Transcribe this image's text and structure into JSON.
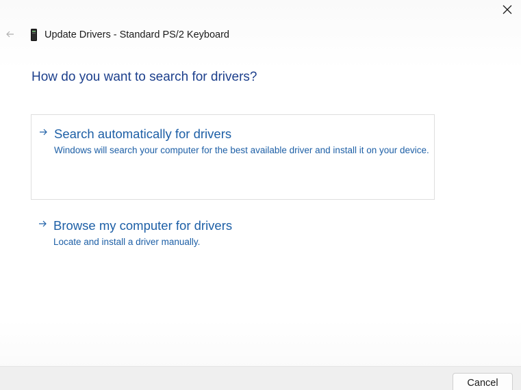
{
  "window": {
    "title": "Update Drivers - Standard PS/2 Keyboard",
    "close_icon": "close-icon",
    "back_icon": "back-arrow-icon",
    "device_icon": "keyboard-device-icon"
  },
  "main": {
    "question": "How do you want to search for drivers?",
    "options": [
      {
        "title": "Search automatically for drivers",
        "description": "Windows will search your computer for the best available driver and install it on your device.",
        "icon": "arrow-right-icon"
      },
      {
        "title": "Browse my computer for drivers",
        "description": "Locate and install a driver manually.",
        "icon": "arrow-right-icon"
      }
    ]
  },
  "footer": {
    "cancel_label": "Cancel"
  },
  "colors": {
    "link_blue": "#1d5fa6",
    "heading_blue": "#1c3f8c",
    "footer_bg": "#efefef"
  }
}
